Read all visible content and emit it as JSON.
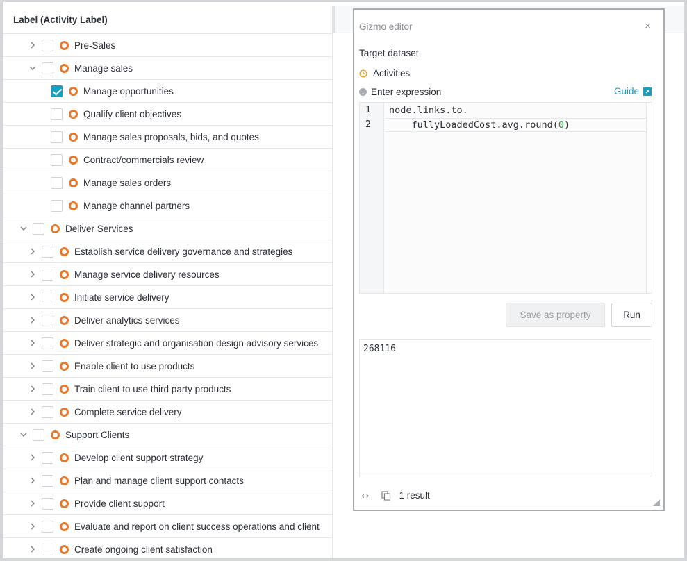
{
  "table": {
    "header": "Label (Activity Label)",
    "rows": [
      {
        "label": "Pre-Sales",
        "level": 1,
        "chevron": "right",
        "checked": false
      },
      {
        "label": "Manage sales",
        "level": 1,
        "chevron": "down",
        "checked": false
      },
      {
        "label": "Manage opportunities",
        "level": 2,
        "chevron": "none",
        "checked": true
      },
      {
        "label": "Qualify client objectives",
        "level": 2,
        "chevron": "none",
        "checked": false
      },
      {
        "label": "Manage sales proposals, bids, and quotes",
        "level": 2,
        "chevron": "none",
        "checked": false
      },
      {
        "label": "Contract/commercials review",
        "level": 2,
        "chevron": "none",
        "checked": false
      },
      {
        "label": "Manage sales orders",
        "level": 2,
        "chevron": "none",
        "checked": false
      },
      {
        "label": "Manage channel partners",
        "level": 2,
        "chevron": "none",
        "checked": false
      },
      {
        "label": "Deliver Services",
        "level": 0,
        "chevron": "down",
        "checked": false
      },
      {
        "label": "Establish service delivery governance and strategies",
        "level": 1,
        "chevron": "right",
        "checked": false
      },
      {
        "label": "Manage service delivery resources",
        "level": 1,
        "chevron": "right",
        "checked": false
      },
      {
        "label": "Initiate service delivery",
        "level": 1,
        "chevron": "right",
        "checked": false
      },
      {
        "label": "Deliver analytics services",
        "level": 1,
        "chevron": "right",
        "checked": false
      },
      {
        "label": "Deliver strategic and organisation design advisory services",
        "level": 1,
        "chevron": "right",
        "checked": false
      },
      {
        "label": "Enable client to use products",
        "level": 1,
        "chevron": "right",
        "checked": false
      },
      {
        "label": "Train client to use third party products",
        "level": 1,
        "chevron": "right",
        "checked": false
      },
      {
        "label": "Complete service delivery",
        "level": 1,
        "chevron": "right",
        "checked": false
      },
      {
        "label": "Support Clients",
        "level": 0,
        "chevron": "down",
        "checked": false
      },
      {
        "label": "Develop client support strategy",
        "level": 1,
        "chevron": "right",
        "checked": false
      },
      {
        "label": "Plan and manage client support contacts",
        "level": 1,
        "chevron": "right",
        "checked": false
      },
      {
        "label": "Provide client support",
        "level": 1,
        "chevron": "right",
        "checked": false
      },
      {
        "label": "Evaluate and report on client success operations and client",
        "level": 1,
        "chevron": "right",
        "checked": false
      },
      {
        "label": "Create ongoing client satisfaction",
        "level": 1,
        "chevron": "right",
        "checked": false
      }
    ]
  },
  "gizmo": {
    "title": "Gizmo editor",
    "close": "×",
    "target_label": "Target dataset",
    "dataset": "Activities",
    "expression_label": "Enter expression",
    "guide": "Guide",
    "code": {
      "line1_no": "1",
      "line2_no": "2",
      "line1": "node.links.to.",
      "line2_pre": "    fullyLoadedCost.avg.round(",
      "line2_num": "0",
      "line2_post": ")"
    },
    "save_button": "Save as property",
    "run_button": "Run",
    "result_value": "268116",
    "footer_code": "‹›",
    "result_count": "1 result"
  },
  "colors": {
    "accent": "#1a9ec0",
    "activity_ring": "#e8782a"
  }
}
